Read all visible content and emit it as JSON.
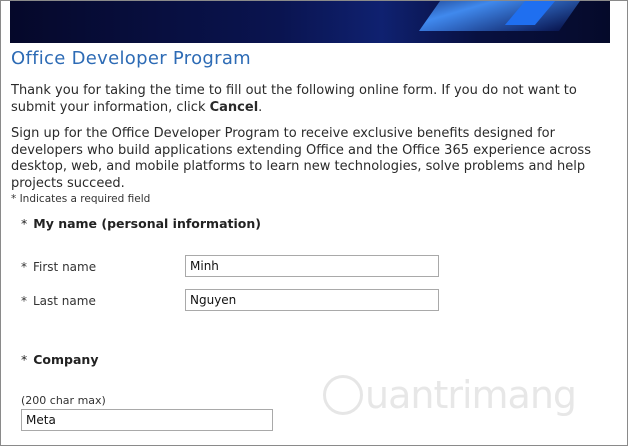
{
  "page": {
    "title": "Office Developer Program",
    "intro_text": "Thank you for taking the time to fill out the following online form. If you do not want to submit your information, click ",
    "intro_cancel": "Cancel",
    "intro_end": ".",
    "signup_text": "Sign up for the Office Developer Program to receive exclusive benefits designed for developers who build applications extending Office and the Office 365 experience across desktop, web, and mobile platforms to learn new technologies, solve problems and help projects succeed.",
    "required_note": "* Indicates a required field"
  },
  "form": {
    "required_mark": "*",
    "name_section": "My name (personal information)",
    "first_name_label": "First name",
    "first_name_value": "Minh",
    "last_name_label": "Last name",
    "last_name_value": "Nguyen",
    "company_section": "Company",
    "company_hint": "(200 char max)",
    "company_value": "Meta"
  },
  "watermark": {
    "text": "uantrimang"
  },
  "colors": {
    "title": "#2d6bb5",
    "banner_dark": "#05082a",
    "banner_accent": "#1f6ff0"
  }
}
